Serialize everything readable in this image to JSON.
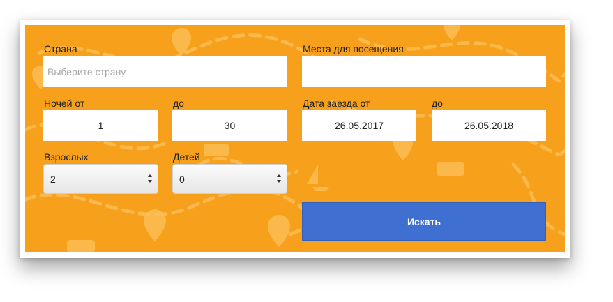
{
  "form": {
    "country": {
      "label": "Страна",
      "placeholder": "Выберите страну",
      "value": ""
    },
    "places": {
      "label": "Места для посещения",
      "value": ""
    },
    "nights_from": {
      "label": "Ночей от",
      "value": "1"
    },
    "nights_to": {
      "label": "до",
      "value": "30"
    },
    "checkin_from": {
      "label": "Дата заезда от",
      "value": "26.05.2017"
    },
    "checkin_to": {
      "label": "до",
      "value": "26.05.2018"
    },
    "adults": {
      "label": "Взрослых",
      "value": "2"
    },
    "children": {
      "label": "Детей",
      "value": "0"
    },
    "search_button": "Искать"
  },
  "colors": {
    "panel": "#f7a01c",
    "button": "#3f6fd1",
    "pattern": "#fbc25a"
  },
  "icons": [
    "map-pin-icon",
    "bus-icon",
    "sailboat-icon",
    "select-arrows-icon"
  ]
}
